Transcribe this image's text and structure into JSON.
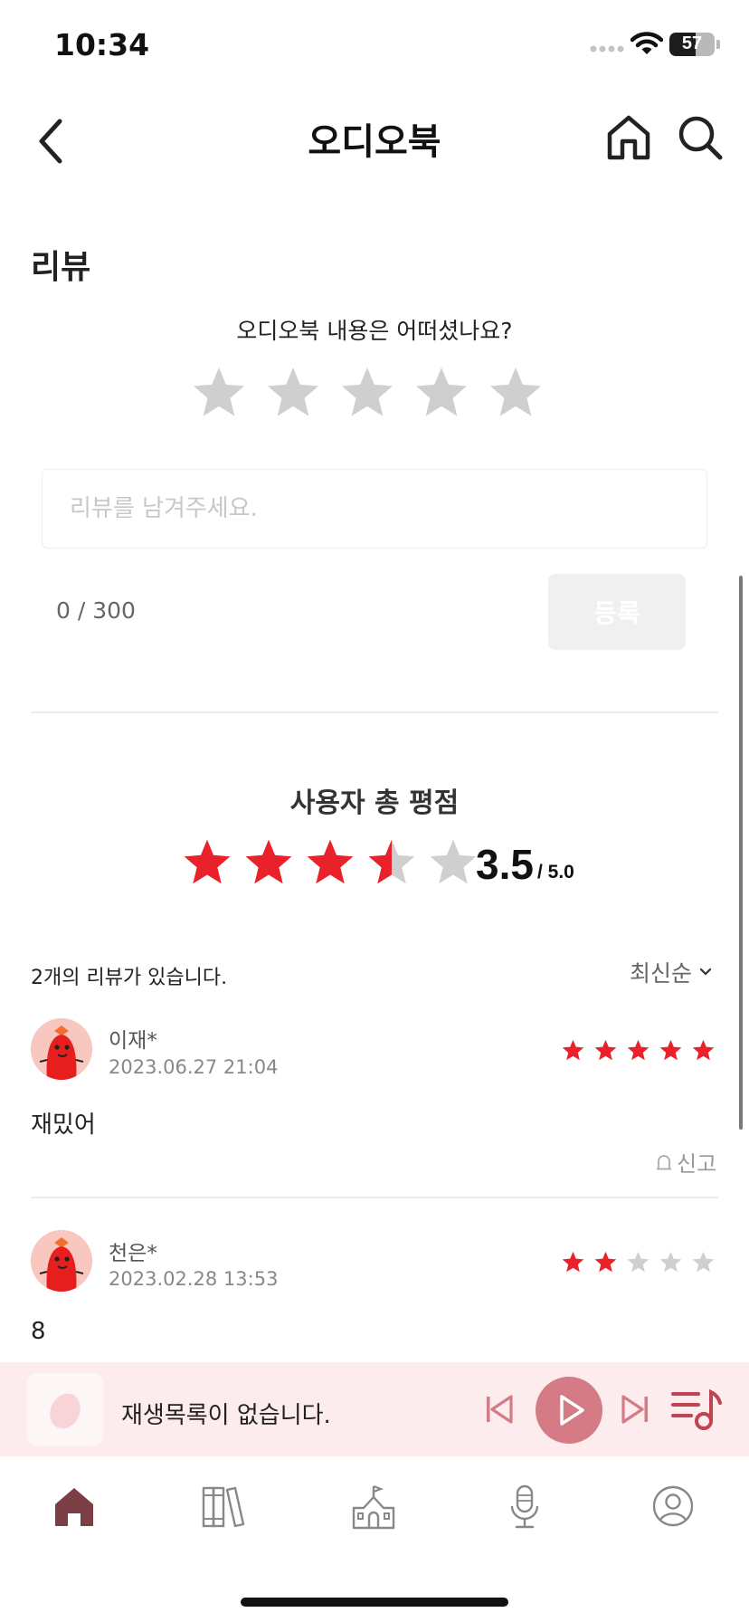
{
  "status_bar": {
    "time": "10:34",
    "battery": "57",
    "battery_level": 0.57
  },
  "header": {
    "title": "오디오북",
    "back_icon": "chevron-left-icon",
    "home_icon": "home-icon",
    "search_icon": "search-icon"
  },
  "review_form": {
    "section_title": "리뷰",
    "question": "오디오북 내용은 어떠셨나요?",
    "star_count": 5,
    "placeholder": "리뷰를 남겨주세요.",
    "char_count": "0 / 300",
    "submit_label": "등록"
  },
  "rating_summary": {
    "title": "사용자 총 평점",
    "score": "3.5",
    "max": "/ 5.0",
    "rating": 3.5
  },
  "reviews": {
    "count_text": "2개의 리뷰가 있습니다.",
    "sort_label": "최신순",
    "items": [
      {
        "user": "이재*",
        "date": "2023.06.27 21:04",
        "text": "재밌어",
        "rating": 5,
        "report_label": "신고"
      },
      {
        "user": "천은*",
        "date": "2023.02.28 13:53",
        "text": "8",
        "rating": 2
      }
    ]
  },
  "player": {
    "empty_text": "재생목록이 없습니다."
  },
  "bottom_nav": {
    "items": [
      {
        "icon": "home-icon",
        "active": true
      },
      {
        "icon": "books-icon",
        "active": false
      },
      {
        "icon": "school-icon",
        "active": false
      },
      {
        "icon": "microphone-icon",
        "active": false
      },
      {
        "icon": "profile-icon",
        "active": false
      }
    ]
  },
  "colors": {
    "accent_red": "#e8212b",
    "inactive_star": "#cfcfcf",
    "player_bg": "#fcecee",
    "player_accent": "#d47b85",
    "nav_active": "#7a3e44"
  }
}
